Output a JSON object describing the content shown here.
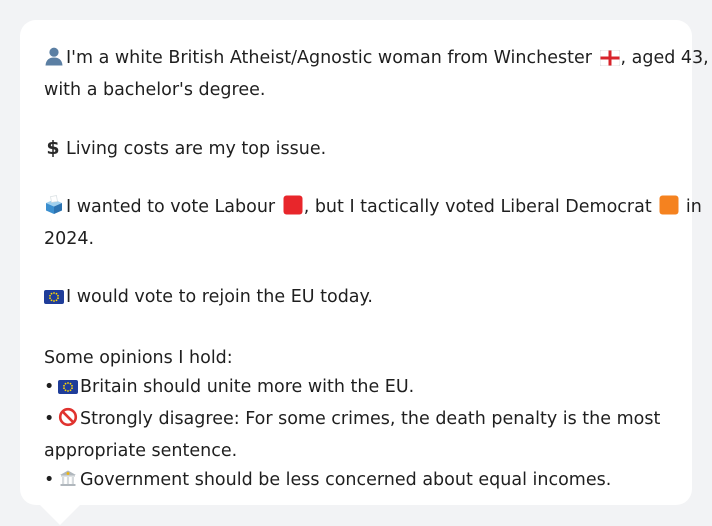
{
  "profile": {
    "intro_line1": "I'm a white British Atheist/Agnostic woman from Winchester",
    "intro_line1_suffix": ", aged 43,",
    "intro_line2": "with a bachelor's degree.",
    "top_issue": "Living costs are my top issue.",
    "vote_part1": "I wanted to vote Labour",
    "vote_part2": ", but I tactically voted Liberal Democrat",
    "vote_part3": " in",
    "vote_year": "2024.",
    "eu_stance": "I would vote to rejoin the EU today.",
    "opinions_heading": "Some opinions I hold:",
    "opinions": [
      {
        "bullet": "•",
        "text": "Britain should unite more with the EU.",
        "icon": "eu-flag-icon"
      },
      {
        "bullet": "•",
        "text_line1": "Strongly disagree: For some crimes, the death penalty is the most",
        "text_line2": "appropriate sentence.",
        "icon": "prohibited-icon"
      },
      {
        "bullet": "•",
        "text": "Government should be less concerned about equal incomes.",
        "icon": "building-icon"
      }
    ]
  },
  "icons": {
    "person": "person-silhouette-icon",
    "england_flag": "england-flag-icon",
    "dollar": "$",
    "ballot": "ballot-box-icon",
    "labour": "red-square-icon",
    "libdem": "orange-square-icon",
    "eu_flag": "eu-flag-icon"
  },
  "colors": {
    "background": "#f2f3f5",
    "bubble": "#ffffff",
    "text": "#1f1f1f",
    "labour": "#e8262b",
    "libdem": "#f5821f",
    "eu_blue": "#1f3d99",
    "eu_star": "#ffd700",
    "prohibited": "#e0332f"
  }
}
